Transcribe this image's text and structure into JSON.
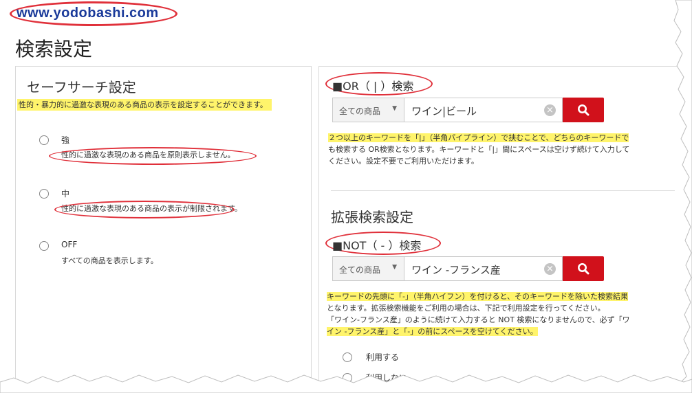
{
  "logo": {
    "text": "www.yodobashi.com"
  },
  "page_title": "検索設定",
  "safe_search": {
    "title": "セーフサーチ設定",
    "description": "性的・暴力的に過激な表現のある商品の表示を設定することができます。",
    "options": [
      {
        "label": "強",
        "desc": "性的に過激な表現のある商品を原則表示しません。"
      },
      {
        "label": "中",
        "desc": "性的に過激な表現のある商品の表示が制限されます。"
      },
      {
        "label": "OFF",
        "desc": "すべての商品を表示します。"
      }
    ]
  },
  "or_search": {
    "title": "■OR（ | ）検索",
    "category": "全ての商品",
    "query": "ワイン|ビール",
    "note_lines": [
      "２つ以上のキーワードを「|」（半角パイプライン）で挟むことで、どちらのキーワードで",
      "も検索する OR検索となります。キーワードと「|」間にスペースは空けず続けて入力して",
      "ください。設定不要でご利用いただけます。"
    ]
  },
  "extended": {
    "title": "拡張検索設定",
    "not_title": "■NOT（ - ）検索",
    "category": "全ての商品",
    "query": "ワイン -フランス産",
    "note_lines": [
      "キーワードの先頭に「-」（半角ハイフン）を付けると、そのキーワードを除いた検索結果",
      "となります。拡張検索機能をご利用の場合は、下記で利用設定を行ってください。",
      "「ワイン-フランス産」のように続けて入力すると NOT 検索になりませんので、必ず「ワ",
      "イン -フランス産」と「-」の前にスペースを空けてください。"
    ],
    "options": [
      {
        "label": "利用する"
      },
      {
        "label": "利用しない"
      }
    ]
  },
  "colors": {
    "accent_red": "#d1111b",
    "highlight": "#fff46b",
    "annotation": "#e0303a",
    "logo_blue": "#1a3a9a"
  },
  "icons": {
    "search": "search-icon",
    "clear": "clear-icon",
    "caret": "chevron-down-icon"
  }
}
